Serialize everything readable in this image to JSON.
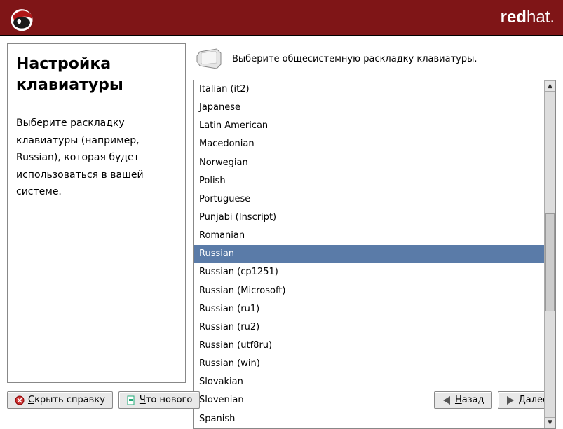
{
  "brand": {
    "bold": "red",
    "light": "hat."
  },
  "help": {
    "title": "Настройка клавиатуры",
    "body": "Выберите раскладку клавиатуры (например, Russian), которая будет использоваться в вашей системе."
  },
  "instruction": "Выберите общесистемную раскладку клавиатуры.",
  "layouts": [
    "Italian (it2)",
    "Japanese",
    "Latin American",
    "Macedonian",
    "Norwegian",
    "Polish",
    "Portuguese",
    "Punjabi (Inscript)",
    "Romanian",
    "Russian",
    "Russian (cp1251)",
    "Russian (Microsoft)",
    "Russian (ru1)",
    "Russian (ru2)",
    "Russian (utf8ru)",
    "Russian (win)",
    "Slovakian",
    "Slovenian",
    "Spanish"
  ],
  "selected_index": 9,
  "buttons": {
    "hide_help": "Скрыть справку",
    "whats_new": "Что нового",
    "back": "Назад",
    "next": "Далее"
  }
}
